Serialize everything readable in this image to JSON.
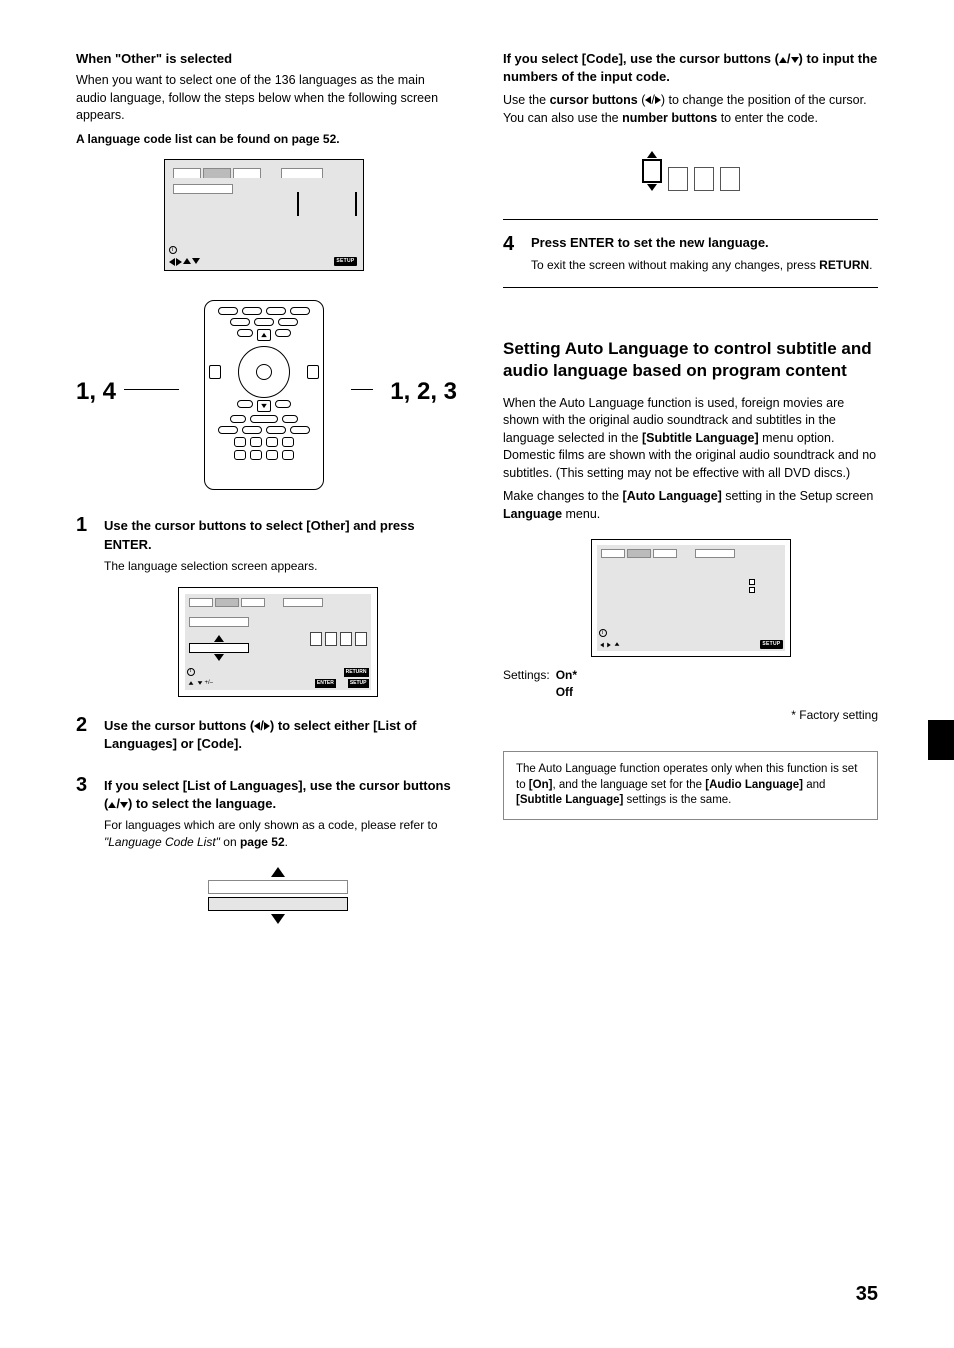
{
  "left": {
    "heading": "When \"Other\" is selected",
    "intro": "When you want to select one of the 136 languages as the main audio language, follow the steps below when the following screen appears.",
    "list_note": "A language code list can be found on page 52.",
    "callout_14": "1, 4",
    "callout_123": "1, 2, 3",
    "screen_setup_label": "SETUP",
    "step1_title": "Use the cursor buttons to select [Other] and press ENTER.",
    "step1_text": "The language selection screen appears.",
    "mini_enter": "ENTER",
    "mini_return": "RETURN",
    "mini_setup": "SETUP",
    "step2_title_a": "Use the cursor buttons (",
    "step2_title_b": ") to select either [List of Languages] or [Code].",
    "step3_title_a": "If you select [List of Languages], use the cursor buttons (",
    "step3_title_b": ") to select the language.",
    "step3_text_a": "For languages which are only shown as a code, please refer to ",
    "step3_ref": "\"Language Code List\"",
    "step3_text_b": " on ",
    "step3_page": "page 52",
    "step3_text_c": "."
  },
  "right": {
    "code_heading_a": "If you select [Code], use the cursor buttons (",
    "code_heading_b": ") to input the numbers of the input code.",
    "code_text_a": "Use the ",
    "code_text_b": "cursor buttons",
    "code_text_c": " (",
    "code_text_d": ") to change the position of the cursor. You can also use the ",
    "code_text_e": "number buttons",
    "code_text_f": " to enter the code.",
    "step4_num": "4",
    "step4_title": "Press ENTER to set the new language.",
    "step4_text_a": "To exit the screen without making any changes, press ",
    "step4_text_b": "RETURN",
    "step4_text_c": ".",
    "section_heading": "Setting Auto Language to control subtitle and audio language based on program content",
    "section_p1_a": "When the Auto Language function is used, foreign movies are shown with the original audio soundtrack and subtitles in the language selected in the ",
    "section_p1_b": "[Subtitle Language]",
    "section_p1_c": " menu option. Domestic films are shown with the original audio soundtrack and no subtitles. (This setting may not be effective with all DVD discs.)",
    "section_p2_a": "Make changes to the ",
    "section_p2_b": "[Auto Language]",
    "section_p2_c": " setting in the Setup screen ",
    "section_p2_d": "Language",
    "section_p2_e": " menu.",
    "setup_label": "SETUP",
    "settings_label": "Settings:",
    "settings_on": "On*",
    "settings_off": "Off",
    "factory": "* Factory setting",
    "note_a": "The Auto Language function operates only when this function is set to ",
    "note_b": "[On]",
    "note_c": ", and the language set for the ",
    "note_d": "[Audio Language]",
    "note_e": " and ",
    "note_f": "[Subtitle Language]",
    "note_g": " settings is the same."
  },
  "page_number": "35"
}
